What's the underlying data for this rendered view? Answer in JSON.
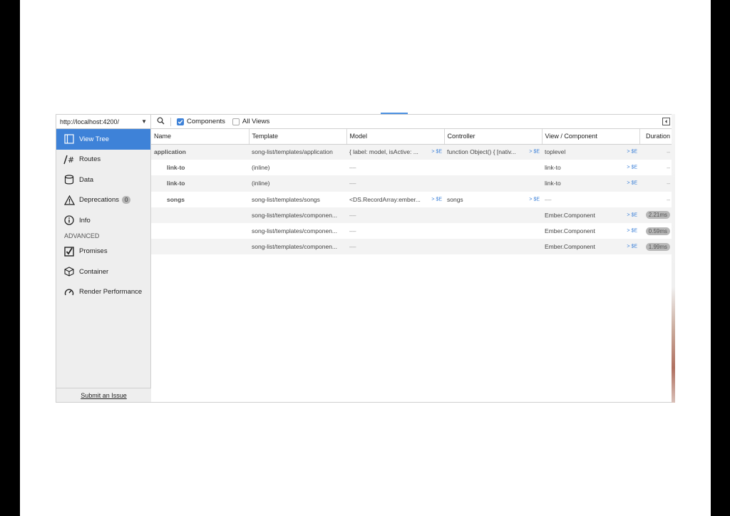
{
  "url": "http://localhost:4200/",
  "sidebar": {
    "items": [
      {
        "label": "View Tree",
        "icon": "view-tree-icon",
        "active": true
      },
      {
        "label": "Routes",
        "icon": "routes-icon"
      },
      {
        "label": "Data",
        "icon": "data-icon"
      },
      {
        "label": "Deprecations",
        "icon": "deprecations-icon",
        "badge": "0"
      },
      {
        "label": "Info",
        "icon": "info-icon"
      }
    ],
    "section": "ADVANCED",
    "advanced": [
      {
        "label": "Promises",
        "icon": "promises-icon"
      },
      {
        "label": "Container",
        "icon": "container-icon"
      },
      {
        "label": "Render Performance",
        "icon": "render-performance-icon"
      }
    ],
    "submit": "Submit an Issue"
  },
  "toolbar": {
    "components_label": "Components",
    "components_checked": true,
    "all_views_label": "All Views",
    "all_views_checked": false
  },
  "table": {
    "columns": [
      "Name",
      "Template",
      "Model",
      "Controller",
      "View / Component",
      "Duration"
    ],
    "rows": [
      {
        "name": "application",
        "template": "song-list/templates/application",
        "model": "{ label: model, isActive: ...",
        "controller": "function Object() { [nativ...",
        "view": "toplevel",
        "duration": "–",
        "indent": 0
      },
      {
        "name": "link-to",
        "template": "(inline)",
        "model": "––",
        "controller": "",
        "view": "link-to",
        "duration": "–",
        "indent": 1
      },
      {
        "name": "link-to",
        "template": "(inline)",
        "model": "––",
        "controller": "",
        "view": "link-to",
        "duration": "–",
        "indent": 1
      },
      {
        "name": "songs",
        "template": "song-list/templates/songs",
        "model": "<DS.RecordArray:ember...",
        "controller": "songs",
        "view": "––",
        "duration": "–",
        "indent": 1
      },
      {
        "name": "",
        "template": "song-list/templates/componen...",
        "model": "––",
        "controller": "",
        "view": "Ember.Component",
        "duration": "2.21ms",
        "indent": 0
      },
      {
        "name": "",
        "template": "song-list/templates/componen...",
        "model": "––",
        "controller": "",
        "view": "Ember.Component",
        "duration": "0.59ms",
        "indent": 0
      },
      {
        "name": "",
        "template": "song-list/templates/componen...",
        "model": "––",
        "controller": "",
        "view": "Ember.Component",
        "duration": "1.99ms",
        "indent": 0
      }
    ],
    "dollar_label": "$E"
  },
  "colors": {
    "accent": "#3e82d8",
    "sidebar_bg": "#eeeeee",
    "row_alt": "#f3f3f3"
  }
}
